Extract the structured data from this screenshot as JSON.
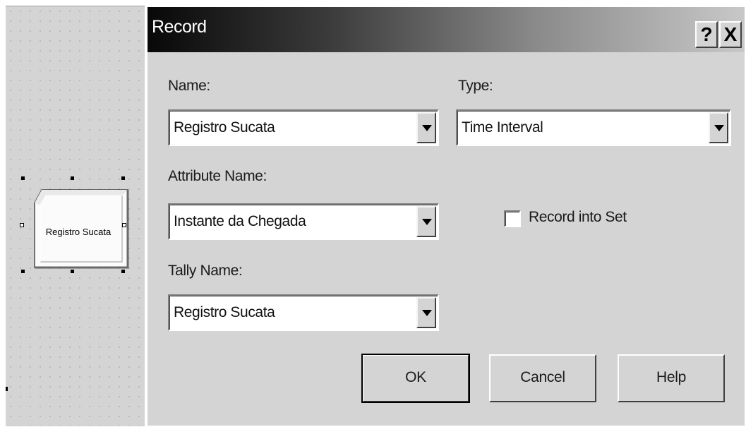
{
  "canvas": {
    "module": {
      "label": "Registro Sucata"
    }
  },
  "dialog": {
    "title": "Record",
    "title_buttons": {
      "help": "?",
      "close": "X"
    },
    "fields": {
      "name": {
        "label": "Name:",
        "value": "Registro Sucata"
      },
      "type": {
        "label": "Type:",
        "value": "Time Interval"
      },
      "attribute_name": {
        "label": "Attribute Name:",
        "value": "Instante da Chegada"
      },
      "record_into_set": {
        "label": "Record into Set",
        "checked": false
      },
      "tally_name": {
        "label": "Tally Name:",
        "value": "Registro Sucata"
      }
    },
    "buttons": {
      "ok": "OK",
      "cancel": "Cancel",
      "help": "Help"
    }
  }
}
